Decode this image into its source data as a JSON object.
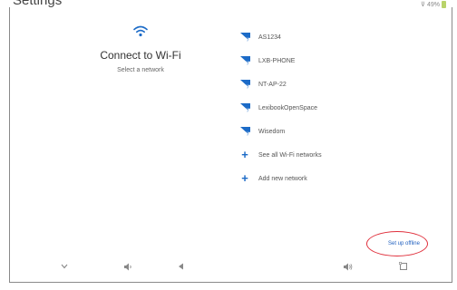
{
  "window": {
    "title": "Settings"
  },
  "status_bar": {
    "battery_text": "⊽ 49%",
    "battery_color": "#b9d36a"
  },
  "left_pane": {
    "icon": "wifi-icon",
    "heading": "Connect to Wi-Fi",
    "subheading": "Select a network"
  },
  "networks": [
    {
      "name": "AS1234",
      "icon": "wifi-signal-icon"
    },
    {
      "name": "LXB-PHONE",
      "icon": "wifi-signal-icon"
    },
    {
      "name": "NT-AP-22",
      "icon": "wifi-signal-icon"
    },
    {
      "name": "LexibookOpenSpace",
      "icon": "wifi-signal-icon"
    },
    {
      "name": "Wisedom",
      "icon": "wifi-signal-icon"
    }
  ],
  "actions": {
    "see_all": "See all Wi-Fi networks",
    "add_new": "Add new network",
    "setup_offline": "Set up offline"
  },
  "nav_bar": [
    "chevron-down-icon",
    "volume-down-icon",
    "back-icon",
    "volume-up-icon",
    "recents-icon"
  ],
  "colors": {
    "accent": "#1c6bc7",
    "annotation_ring": "#e0303c"
  }
}
